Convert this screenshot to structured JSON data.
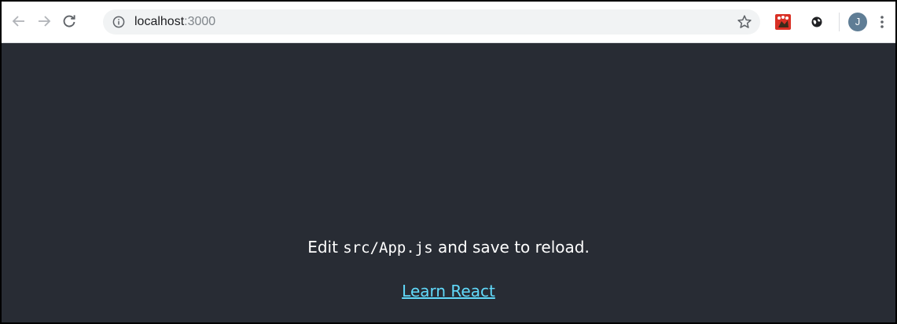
{
  "browser": {
    "url_host": "localhost",
    "url_port": ":3000",
    "avatar_initial": "J",
    "icons": {
      "back": "arrow-left-icon",
      "forward": "arrow-right-icon",
      "reload": "reload-icon",
      "info": "info-icon",
      "star": "star-icon",
      "extension1": "extension-icon",
      "extension2": "extension-icon",
      "menu": "kebab-menu-icon"
    }
  },
  "page": {
    "background": "#282c34",
    "text_color": "#ffffff",
    "link_color": "#61dafb",
    "edit_prefix": "Edit ",
    "edit_code": "src/App.js",
    "edit_suffix": " and save to reload.",
    "link_text": "Learn React"
  }
}
